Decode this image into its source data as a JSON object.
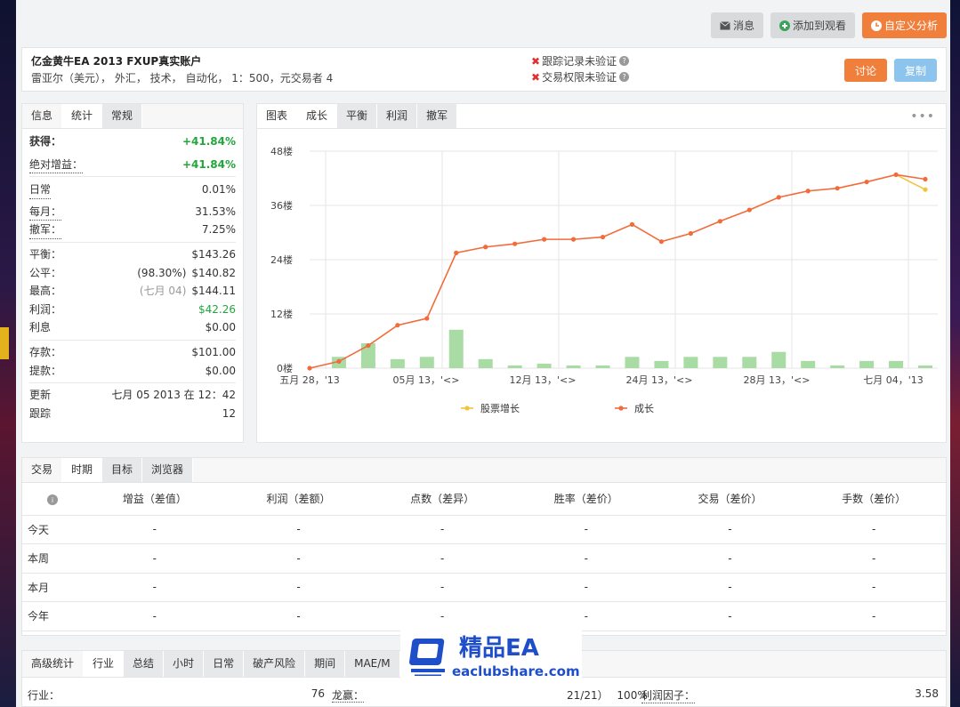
{
  "toolbar": {
    "message_label": "消息",
    "watch_label": "添加到观看",
    "custom_label": "自定义分析"
  },
  "account": {
    "title": "亿金黄牛EA 2013 FXUP真实账户",
    "subtitle": "雷亚尔（美元），  外汇，  技术，  自动化，  1：500，元交易者 4",
    "verify1": "跟踪记录未验证",
    "verify2": "交易权限未验证",
    "discuss_label": "讨论",
    "copy_label": "复制"
  },
  "info_tabs": [
    "信息",
    "统计",
    "常规"
  ],
  "stats": {
    "gain_label": "获得：",
    "gain_value": "+41.84%",
    "abs_label": "绝对增益：",
    "abs_value": "+41.84%",
    "daily_label": "日常",
    "daily_value": "0.01%",
    "monthly_label": "每月：",
    "monthly_value": "31.53%",
    "drawdown_label": "撤军：",
    "drawdown_value": "7.25%",
    "balance_label": "平衡：",
    "balance_value": "$143.26",
    "equity_label": "公平：",
    "equity_pct": "(98.30%)",
    "equity_value": "$140.82",
    "highest_label": "最高：",
    "highest_date": "(七月 04)",
    "highest_value": "$144.11",
    "profit_label": "利润：",
    "profit_value": "$42.26",
    "interest_label": "利息",
    "interest_value": "$0.00",
    "deposit_label": "存款：",
    "deposit_value": "$101.00",
    "withdraw_label": "提款：",
    "withdraw_value": "$0.00",
    "updated_label": "更新",
    "updated_value": "七月 05 2013 在 12：42",
    "tracking_label": "跟踪",
    "tracking_value": "12"
  },
  "chart_tabs": [
    "图表",
    "成长",
    "平衡",
    "利润",
    "撤军"
  ],
  "chart_data": {
    "type": "line",
    "y_ticks": [
      "0楼",
      "12楼",
      "24楼",
      "36楼",
      "48楼"
    ],
    "ylim": [
      0,
      48
    ],
    "x_ticks": [
      "五月 28，'13",
      "05月 13，'<>",
      "12月 13，'<>",
      "24月 13，'<>",
      "28月 13，'<>",
      "七月 04，'13"
    ],
    "series": [
      {
        "name": "成长",
        "color": "#f26b3a",
        "values": [
          0,
          1.5,
          5,
          9.5,
          11,
          25.5,
          26.8,
          27.5,
          28.5,
          28.5,
          29,
          31.8,
          28,
          29.8,
          32.5,
          35,
          37.8,
          39.2,
          39.8,
          41.2,
          42.8,
          41.8
        ]
      },
      {
        "name": "股票增长",
        "color": "#f2c43a",
        "values": [
          null,
          null,
          null,
          null,
          null,
          null,
          null,
          null,
          null,
          null,
          null,
          null,
          null,
          null,
          null,
          null,
          null,
          null,
          null,
          null,
          42.8,
          39.5
        ]
      }
    ],
    "bars": [
      0,
      2.5,
      5.5,
      2,
      2.5,
      8.5,
      2,
      0.6,
      1,
      0.6,
      0.6,
      2.5,
      1.6,
      2.5,
      2.5,
      2.5,
      3.6,
      1.6,
      0.6,
      1.6,
      1.6,
      0.6
    ]
  },
  "period_tabs": [
    "交易",
    "时期",
    "目标",
    "浏览器"
  ],
  "period_table": {
    "headers": [
      "增益（差值）",
      "利润（差额）",
      "点数（差异）",
      "胜率（差价）",
      "交易（差价）",
      "手数（差价）"
    ],
    "rows": [
      {
        "label": "今天",
        "cells": [
          "-",
          "-",
          "-",
          "-",
          "-",
          "-"
        ]
      },
      {
        "label": "本周",
        "cells": [
          "-",
          "-",
          "-",
          "-",
          "-",
          "-"
        ]
      },
      {
        "label": "本月",
        "cells": [
          "-",
          "-",
          "-",
          "-",
          "-",
          "-"
        ]
      },
      {
        "label": "今年",
        "cells": [
          "-",
          "-",
          "-",
          "-",
          "-",
          "-"
        ]
      }
    ]
  },
  "adv_tabs": [
    "高级统计",
    "行业",
    "总结",
    "小时",
    "日常",
    "破产风险",
    "期间",
    "MAE/M"
  ],
  "adv_row": {
    "industry_label": "行业：",
    "industry_value": "76",
    "longwin_label": "龙赢：",
    "longwin_value": "21/21）",
    "pct_value": "100%",
    "pf_label": "利润因子：",
    "pf_value": "3.58"
  },
  "watermark": {
    "brand": "精品EA",
    "url": "eaclubshare.com"
  }
}
